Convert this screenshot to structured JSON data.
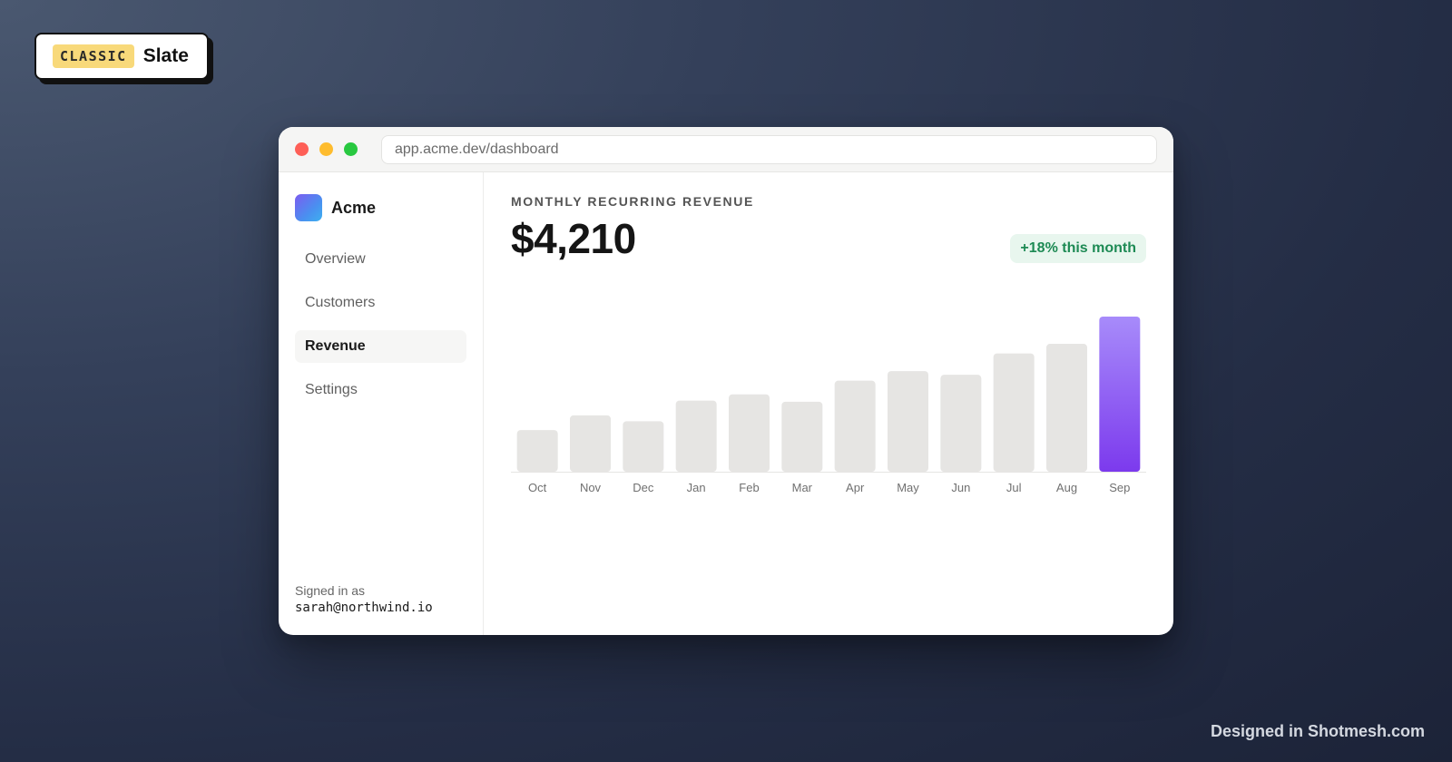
{
  "badge": {
    "tag": "CLASSIC",
    "name": "Slate"
  },
  "browser": {
    "url": "app.acme.dev/dashboard"
  },
  "sidebar": {
    "brand": "Acme",
    "items": [
      {
        "label": "Overview",
        "active": false
      },
      {
        "label": "Customers",
        "active": false
      },
      {
        "label": "Revenue",
        "active": true
      },
      {
        "label": "Settings",
        "active": false
      }
    ],
    "signed_in_label": "Signed in as",
    "signed_in_email": "sarah@northwind.io"
  },
  "main": {
    "kpi_label": "MONTHLY RECURRING REVENUE",
    "kpi_value": "$4,210",
    "delta": "+18% this month"
  },
  "chart_data": {
    "type": "bar",
    "categories": [
      "Oct",
      "Nov",
      "Dec",
      "Jan",
      "Feb",
      "Mar",
      "Apr",
      "May",
      "Jun",
      "Jul",
      "Aug",
      "Sep"
    ],
    "values": [
      1130,
      1530,
      1370,
      1930,
      2100,
      1900,
      2470,
      2730,
      2630,
      3210,
      3470,
      4210
    ],
    "highlight_index": 11,
    "title": "",
    "xlabel": "",
    "ylabel": "",
    "ylim": [
      0,
      4210
    ],
    "colors": {
      "bar": "#e6e5e3",
      "highlight_top": "#a78bfa",
      "highlight_bottom": "#7c3aed",
      "axis": "#e6e5e3",
      "tick": "#707070"
    }
  },
  "footer": {
    "credit": "Designed in Shotmesh.com"
  }
}
